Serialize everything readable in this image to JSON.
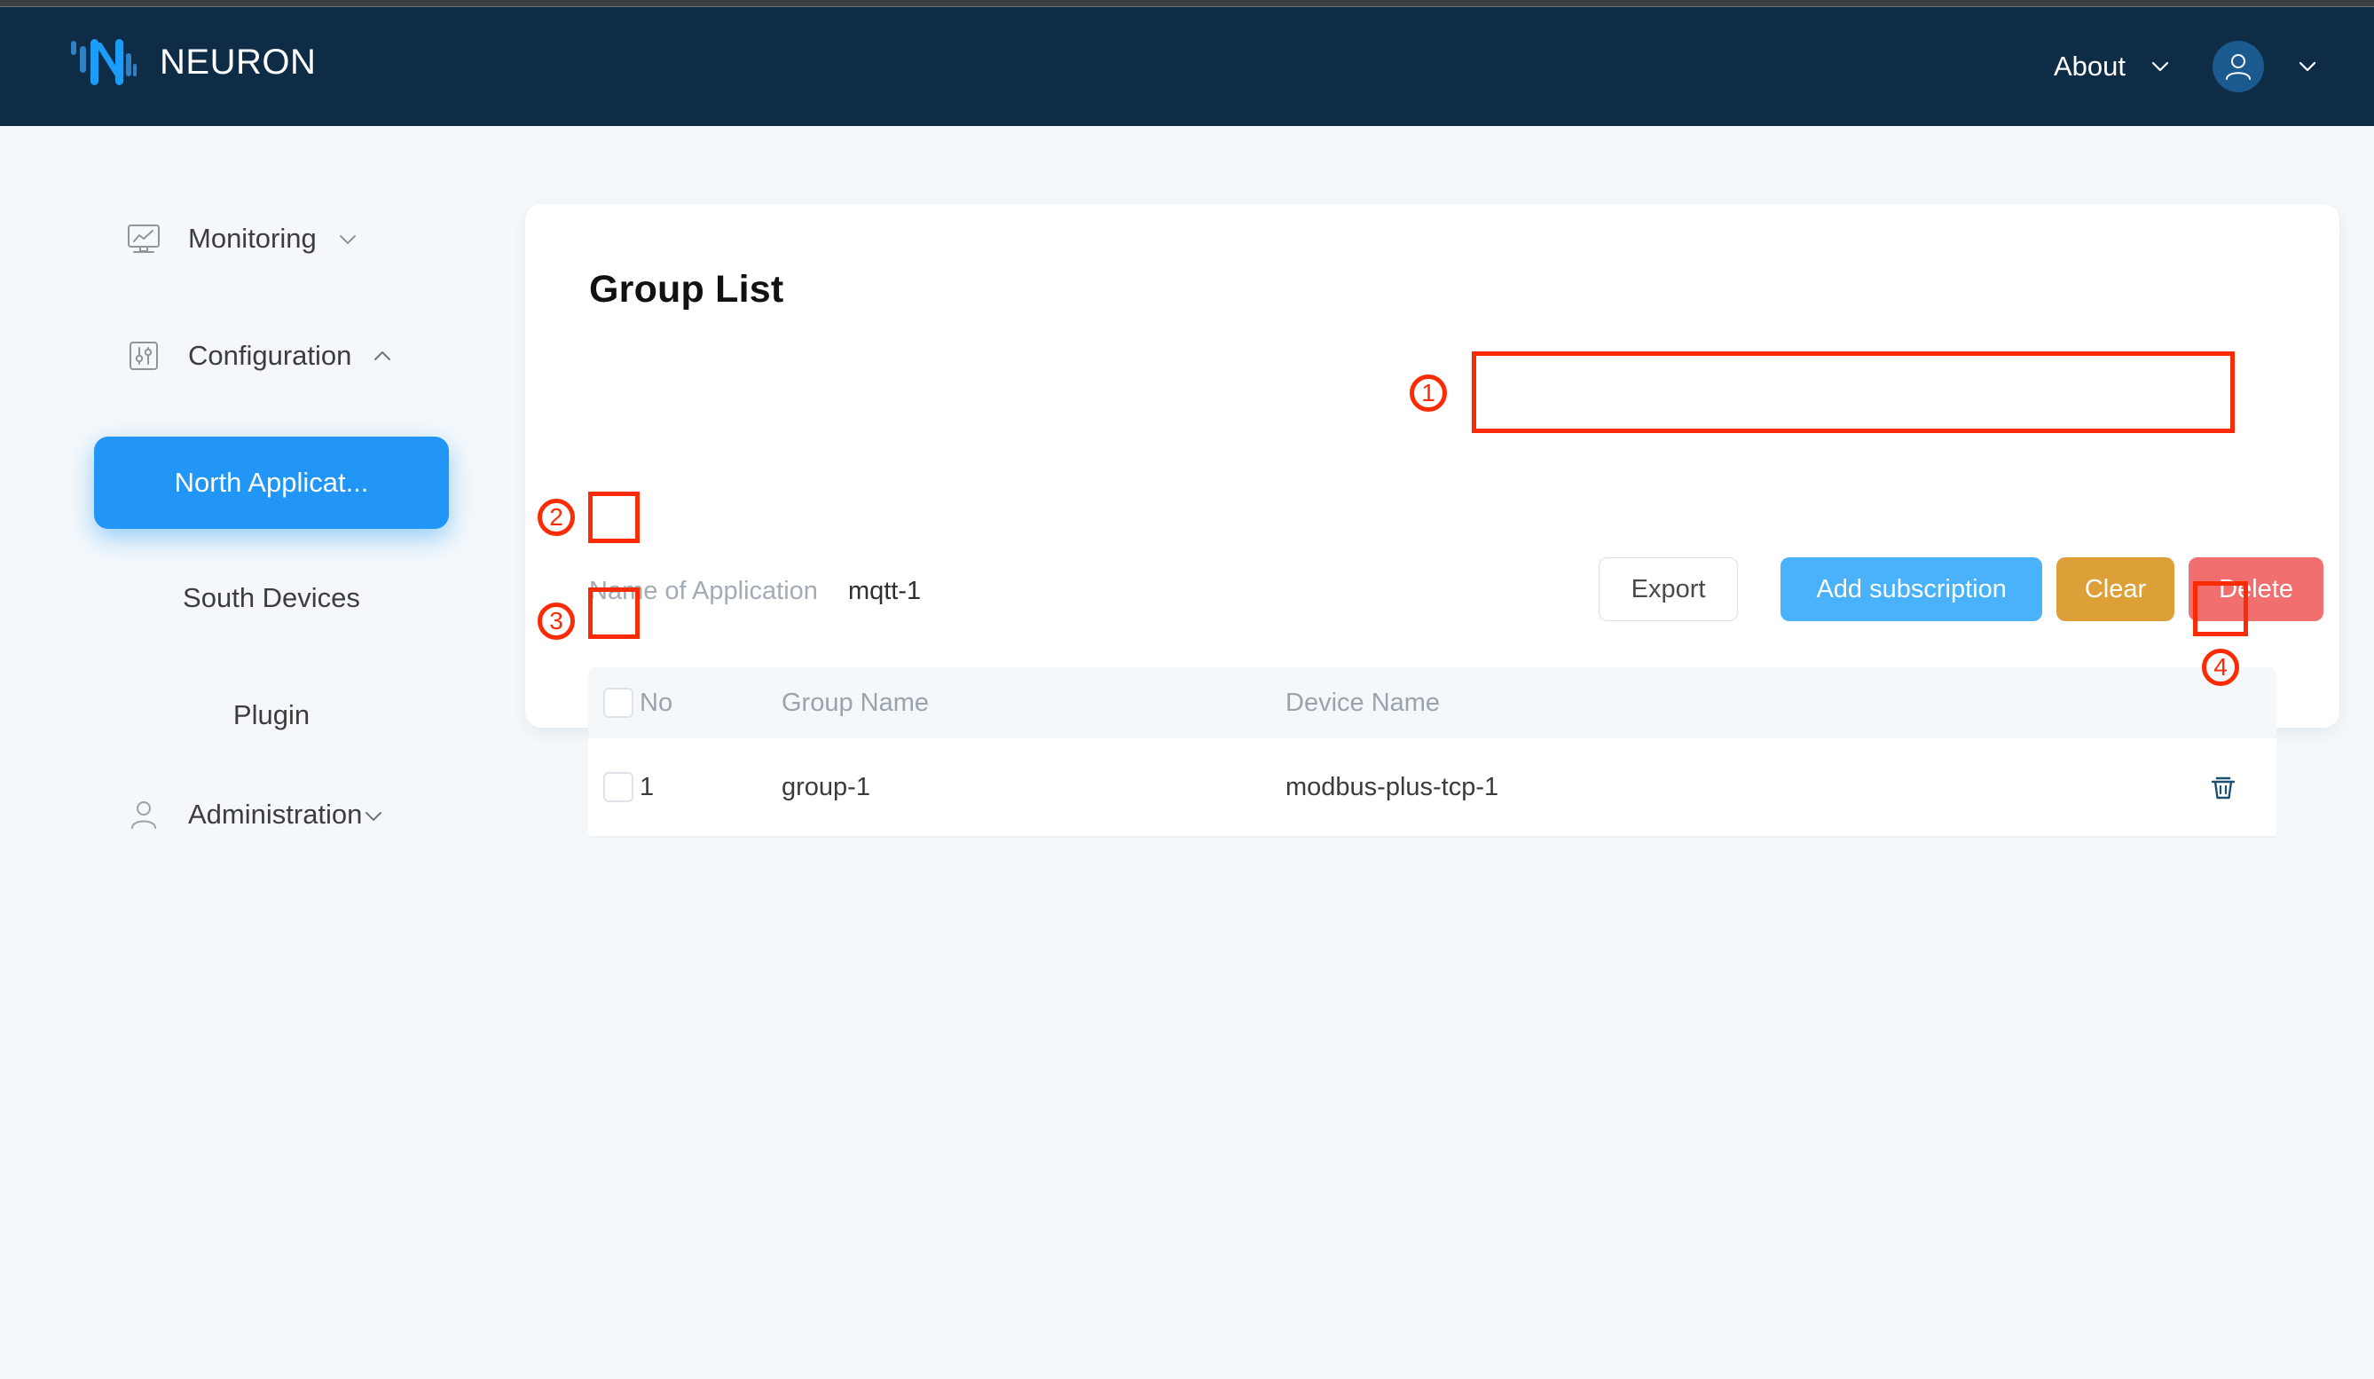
{
  "header": {
    "brand": "NEURON",
    "logo_icon": "neuron-logo-icon",
    "about_label": "About",
    "about_caret_icon": "chevron-down-icon",
    "avatar_icon": "user-avatar-icon",
    "avatar_caret_icon": "chevron-down-icon",
    "background": "#0f2c47"
  },
  "sidebar": {
    "groups": [
      {
        "label": "Monitoring",
        "icon": "monitor-chart-icon",
        "caret": "chevron-down-icon"
      },
      {
        "label": "Configuration",
        "icon": "sliders-icon",
        "caret": "chevron-up-icon"
      },
      {
        "label": "Administration",
        "icon": "user-outline-icon",
        "caret": "chevron-down-icon"
      }
    ],
    "items": [
      {
        "label": "North Applicat...",
        "active": true
      },
      {
        "label": "South Devices",
        "active": false
      },
      {
        "label": "Plugin",
        "active": false
      }
    ],
    "active_color": "#2196f7"
  },
  "card": {
    "title": "Group List",
    "application_label": "Name of Application",
    "application_value": "mqtt-1"
  },
  "toolbar": {
    "export_label": "Export",
    "add_subscription_label": "Add subscription",
    "clear_label": "Clear",
    "delete_label": "Delete",
    "colors": {
      "export_bg": "#ffffff",
      "add_bg": "#49b2fa",
      "clear_bg": "#dda038",
      "delete_bg": "#f16f6f"
    }
  },
  "table": {
    "select_all_checkbox": "select-all-checkbox",
    "columns": [
      "No",
      "Group Name",
      "Device Name"
    ],
    "rows": [
      {
        "no": "1",
        "group_name": "group-1",
        "device_name": "modbus-plus-tcp-1",
        "delete_icon": "trash-icon",
        "checked": false
      }
    ]
  },
  "annotations": [
    {
      "id": "1",
      "target": "toolbar"
    },
    {
      "id": "2",
      "target": "select-all-checkbox"
    },
    {
      "id": "3",
      "target": "row-checkbox"
    },
    {
      "id": "4",
      "target": "row-delete-icon"
    }
  ],
  "annotation_color": "#fb2c05"
}
